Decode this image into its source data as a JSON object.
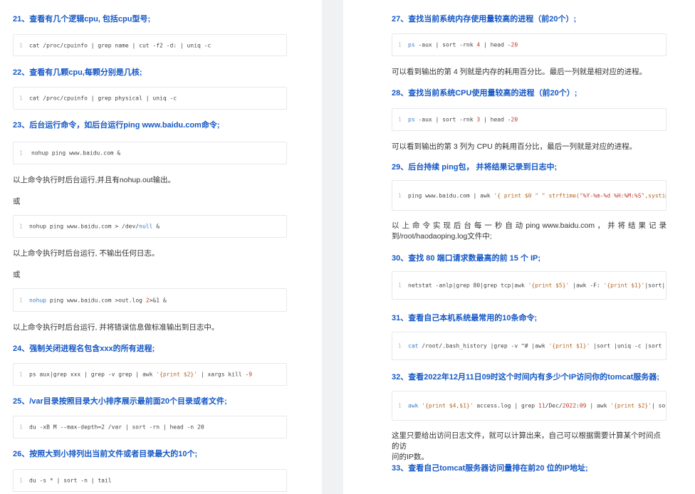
{
  "left": {
    "h21": "21、查看有几个逻辑cpu, 包括cpu型号;",
    "c21": "cat /proc/cpuinfo | grep name | cut -f2 -d: | uniq -c",
    "h22": "22、查看有几颗cpu,每颗分别是几核;",
    "c22": "cat /proc/cpuinfo | grep physical | uniq -c",
    "h23": "23、后台运行命令，如后台运行ping www.baidu.com命令;",
    "c23a": "nohup ping www.baidu.com &",
    "p23a": "以上命令执行时后台运行,并且有nohup.out输出。",
    "or1": "或",
    "c23b_pre": "nohup ping www.baidu.com > /dev/",
    "c23b_kw": "null",
    "c23b_post": " &",
    "p23b": "以上命令执行时后台运行, 不输出任何日志。",
    "or2": "或",
    "c23c_kw": "nohup",
    "c23c_mid": " ping www.baidu.com >out.log ",
    "c23c_num": "2",
    "c23c_post": ">&1 &",
    "p23c": "以上命令执行时后台运行, 并将错误信息做标准输出到日志中。",
    "h24": "24、强制关闭进程名包含xxx的所有进程;",
    "c24_pre": "ps aux|grep xxx | grep -v grep | awk ",
    "c24_str": "'{print $2}'",
    "c24_mid": " | xargs kill -",
    "c24_num": "9",
    "h25": "25、/var目录按照目录大小排序展示最前面20个目录或者文件;",
    "c25": "du -xB M --max-depth=2 /var | sort -rn | head -n 20",
    "h26": "26、按照大到小排列出当前文件或者目录最大的10个;",
    "c26": "du -s * | sort -n | tail"
  },
  "right": {
    "h27": "27、查找当前系统内存使用量较高的进程（前20个）;",
    "c27_kw": "ps",
    "c27_mid": " -aux | sort -rnk ",
    "c27_n1": "4",
    "c27_mid2": " | head -",
    "c27_n2": "20",
    "p27": "可以看到输出的第 4 列就是内存的耗用百分比。最后一列就是相对应的进程。",
    "h28": "28、查找当前系统CPU使用量较高的进程（前20个）;",
    "c28_kw": "ps",
    "c28_mid": " -aux | sort -rnk ",
    "c28_n1": "3",
    "c28_mid2": " | head -",
    "c28_n2": "20",
    "p28": "可以看到输出的第 3 列为 CPU 的耗用百分比，最后一列就是对应的进程。",
    "h29": "29、后台持续 ping包， 并将结果记录到日志中;",
    "c29_pre": "ping www.baidu.com | awk ",
    "c29_str1": "'{ print $0 \" \" strftime(\"",
    "c29_fmt": "%Y-%m-%d %H:%M:%S",
    "c29_post": "\",systime",
    "p29a": "以 上 命 令 实 现 后 台 每 一 秒 自 动 ping www.baidu.com ， 并 将 结 果 记 录",
    "p29b": "到/root/haodaoping.log文件中;",
    "h30": "30、查找 80 端口请求数最高的前 15 个 IP;",
    "c30_pre": "netstat -anlp|grep 80|grep tcp|awk ",
    "c30_str1": "'{print $5}'",
    "c30_mid": " |awk -F: ",
    "c30_str2": "'{print $1}'",
    "c30_post": "|sort|uni",
    "h31": "31、查看自己本机系统最常用的10条命令;",
    "c31_kw": "cat",
    "c31_mid": " /root/.bash_history |grep -v ^# |awk ",
    "c31_str": "'{print $1}'",
    "c31_post": " |sort |uniq -c |sort -nr",
    "h32": "32、查看2022年12月11日09时这个时间内有多少个IP访问你的tomcat服务器;",
    "c32_kw": "awk",
    "c32_str1": " '{print $4,$1}'",
    "c32_mid": " access.log | grep ",
    "c32_n1": "11",
    "c32_mid2": "/Dec/",
    "c32_n2": "2022",
    "c32_mid3": ":",
    "c32_n3": "09",
    "c32_mid4": " | awk ",
    "c32_str2": "'{print $2}'",
    "c32_post": "| sort",
    "p32a": "这里只要给出访问日志文件，就可以计算出来，自己可以根据需要计算某个时间点的访",
    "p32b": "问的IP数。",
    "h33": "33、查看自己tomcat服务器访问量排在前20 位的IP地址;"
  },
  "line_number": "1"
}
